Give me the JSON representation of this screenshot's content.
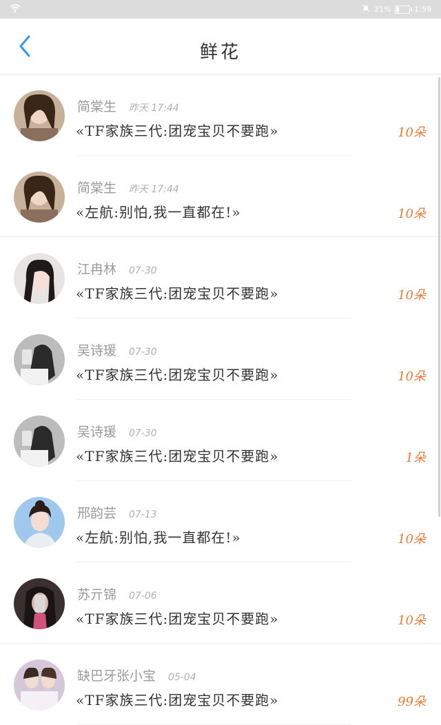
{
  "status": {
    "battery": "21%",
    "time": "1:59",
    "battery_level": 0.21
  },
  "header": {
    "title": "鲜花"
  },
  "items": [
    {
      "name": "简棠生",
      "time": "昨天 17:44",
      "work": "«TF家族三代:团宠宝贝不要跑»",
      "count": "10朵"
    },
    {
      "name": "简棠生",
      "time": "昨天 17:44",
      "work": "«左航:别怕,我一直都在!»",
      "count": "10朵"
    },
    {
      "name": "江冉林",
      "time": "07-30",
      "work": "«TF家族三代:团宠宝贝不要跑»",
      "count": "10朵"
    },
    {
      "name": "吴诗瑗",
      "time": "07-30",
      "work": "«TF家族三代:团宠宝贝不要跑»",
      "count": "10朵"
    },
    {
      "name": "吴诗瑗",
      "time": "07-30",
      "work": "«TF家族三代:团宠宝贝不要跑»",
      "count": "1朵"
    },
    {
      "name": "邢韵芸",
      "time": "07-13",
      "work": "«左航:别怕,我一直都在!»",
      "count": "10朵"
    },
    {
      "name": "苏亓锦",
      "time": "07-06",
      "work": "«TF家族三代:团宠宝贝不要跑»",
      "count": "10朵"
    },
    {
      "name": "缺巴牙张小宝",
      "time": "05-04",
      "work": "«TF家族三代:团宠宝贝不要跑»",
      "count": "99朵"
    }
  ]
}
